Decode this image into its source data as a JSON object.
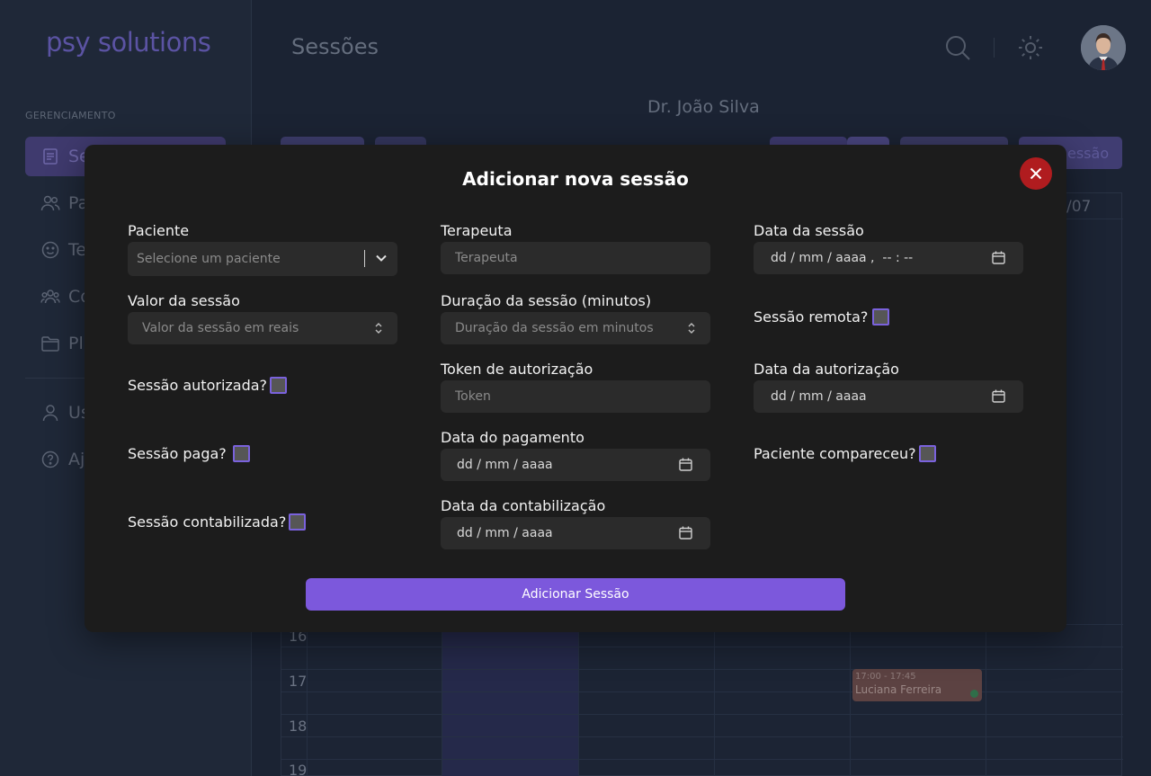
{
  "app": {
    "logo": "psy solutions",
    "page_title": "Sessões",
    "therapist_name": "Dr. João Silva"
  },
  "sidebar": {
    "section_label": "GERENCIAMENTO",
    "items": [
      {
        "label": "Se",
        "icon": "document-icon",
        "active": true
      },
      {
        "label": "Pa",
        "icon": "users-icon"
      },
      {
        "label": "Te",
        "icon": "smile-icon"
      },
      {
        "label": "Co",
        "icon": "group-icon"
      },
      {
        "label": "Pl",
        "icon": "folder-icon"
      }
    ],
    "bottom_items": [
      {
        "label": "Us",
        "icon": "user-icon"
      },
      {
        "label": "Aj",
        "icon": "help-icon"
      }
    ]
  },
  "toolbar": {
    "add_session_fragment": "essão"
  },
  "calendar": {
    "visible_date_fragment": "/07",
    "hours": [
      "16",
      "17",
      "18",
      "19"
    ],
    "event": {
      "time": "17:00 - 17:45",
      "patient": "Luciana Ferreira"
    }
  },
  "modal": {
    "title": "Adicionar nova sessão",
    "fields": {
      "patient": {
        "label": "Paciente",
        "placeholder": "Selecione um paciente"
      },
      "therapist": {
        "label": "Terapeuta",
        "placeholder": "Terapeuta"
      },
      "session_date": {
        "label": "Data da sessão",
        "placeholder": "dd / mm / aaaa ,  -- : --"
      },
      "session_value": {
        "label": "Valor da sessão",
        "placeholder": "Valor da sessão em reais"
      },
      "duration": {
        "label": "Duração da sessão (minutos)",
        "placeholder": "Duração da sessão em minutos"
      },
      "remote": {
        "label": "Sessão remota?"
      },
      "authorized": {
        "label": "Sessão autorizada?"
      },
      "auth_token": {
        "label": "Token de autorização",
        "placeholder": "Token"
      },
      "auth_date": {
        "label": "Data da autorização",
        "placeholder": "dd / mm / aaaa"
      },
      "paid": {
        "label": "Sessão paga?"
      },
      "payment_date": {
        "label": "Data do pagamento",
        "placeholder": "dd / mm / aaaa"
      },
      "attended": {
        "label": "Paciente compareceu?"
      },
      "accounted": {
        "label": "Sessão contabilizada?"
      },
      "accounting_date": {
        "label": "Data da contabilização",
        "placeholder": "dd / mm / aaaa"
      }
    },
    "submit_label": "Adicionar Sessão"
  },
  "colors": {
    "accent": "#7c58dc",
    "close": "#b01c1f",
    "modal_bg": "#1c1c1c",
    "input_bg": "#2b2b2b"
  }
}
